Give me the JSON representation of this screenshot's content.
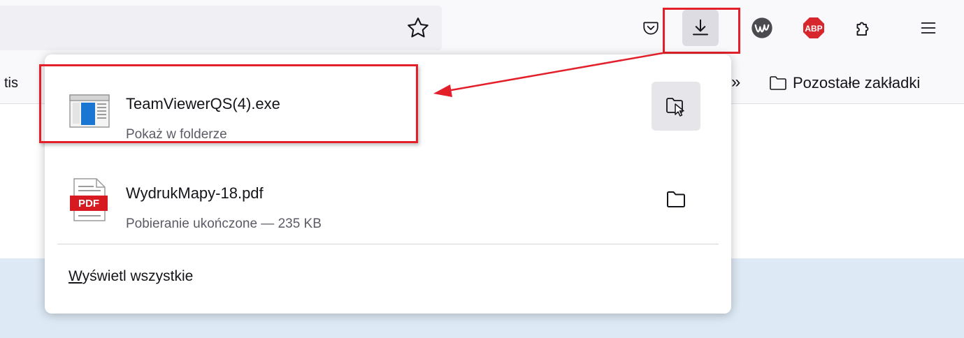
{
  "toolbar": {
    "bookmark_star": "star-icon",
    "pocket": "pocket-icon",
    "downloads": "download-icon",
    "extension_w": "w-extension-icon",
    "adblock_label": "ABP",
    "extensions": "puzzle-icon",
    "menu": "hamburger-menu-icon"
  },
  "bookmarks": {
    "partial_left": "tis",
    "overflow": "»",
    "other_bookmarks": "Pozostałe zakładki"
  },
  "downloads_panel": {
    "items": [
      {
        "filename": "TeamViewerQS(4).exe",
        "status": "Pokaż w folderze",
        "icon": "exe-file-icon",
        "action_icon": "open-folder-cursor-icon"
      },
      {
        "filename": "WydrukMapy-18.pdf",
        "status": "Pobieranie ukończone — 235 KB",
        "icon": "pdf-file-icon",
        "badge": "PDF",
        "action_icon": "folder-icon"
      }
    ],
    "show_all_underlined": "W",
    "show_all_rest": "yświetl wszystkie"
  },
  "colors": {
    "annotation_red": "#e3202a",
    "abp_red": "#d7262c",
    "pdf_red": "#d71921",
    "exe_blue": "#1976d2"
  }
}
